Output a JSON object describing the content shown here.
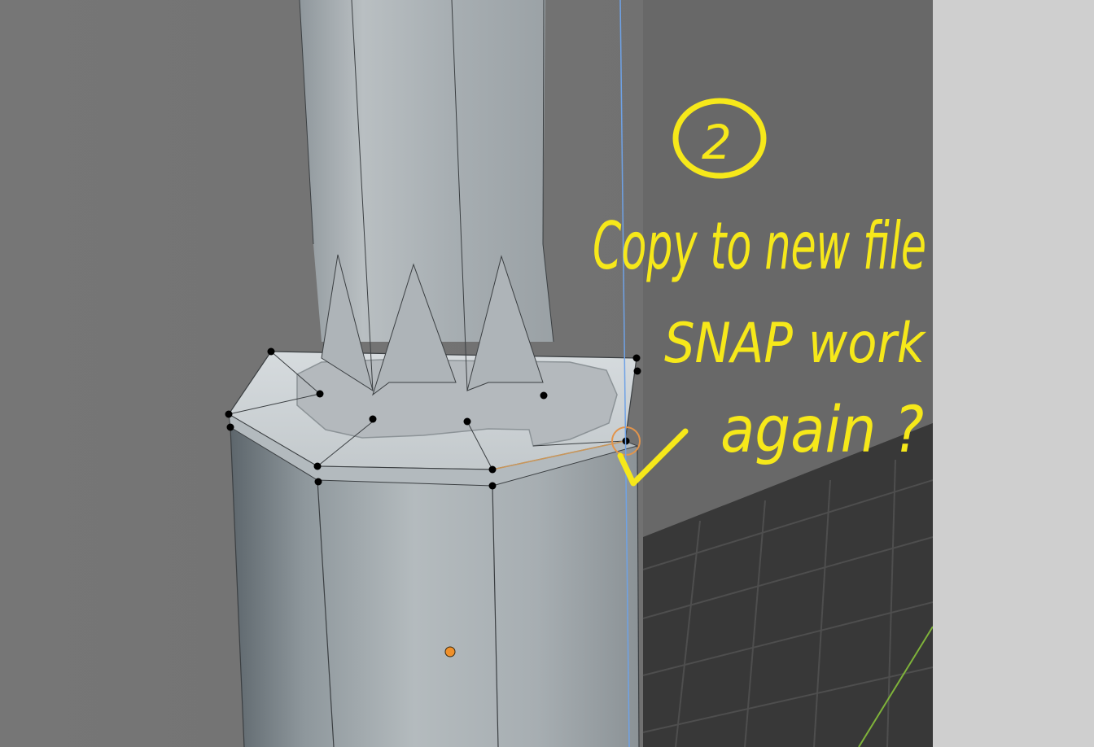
{
  "viewport": {
    "type": "3d-mesh-edit-view"
  },
  "colors": {
    "wall_left": "#727272",
    "wall_right": "#6a6a6a",
    "floor": "#3a3a3a",
    "floor_grid": "#4a4a4a",
    "mesh_light": "#c9ced1",
    "mesh_mid": "#a9b0b4",
    "mesh_dark": "#6f787e",
    "cap_top": "#dde2e5",
    "selected_face": "#b9bec2",
    "vertex": "#000000",
    "axis_blue": "#6fa2e6",
    "axis_green": "#7fb33a",
    "origin_orange": "#f0902a",
    "annotation": "#f6e81a",
    "side_panel": "#cfcfcf"
  },
  "annotation": {
    "step_number": "2",
    "line1": "Copy to new file",
    "line2": "SNAP work",
    "line3": "again ?",
    "checkmark": "checkmark-icon"
  }
}
